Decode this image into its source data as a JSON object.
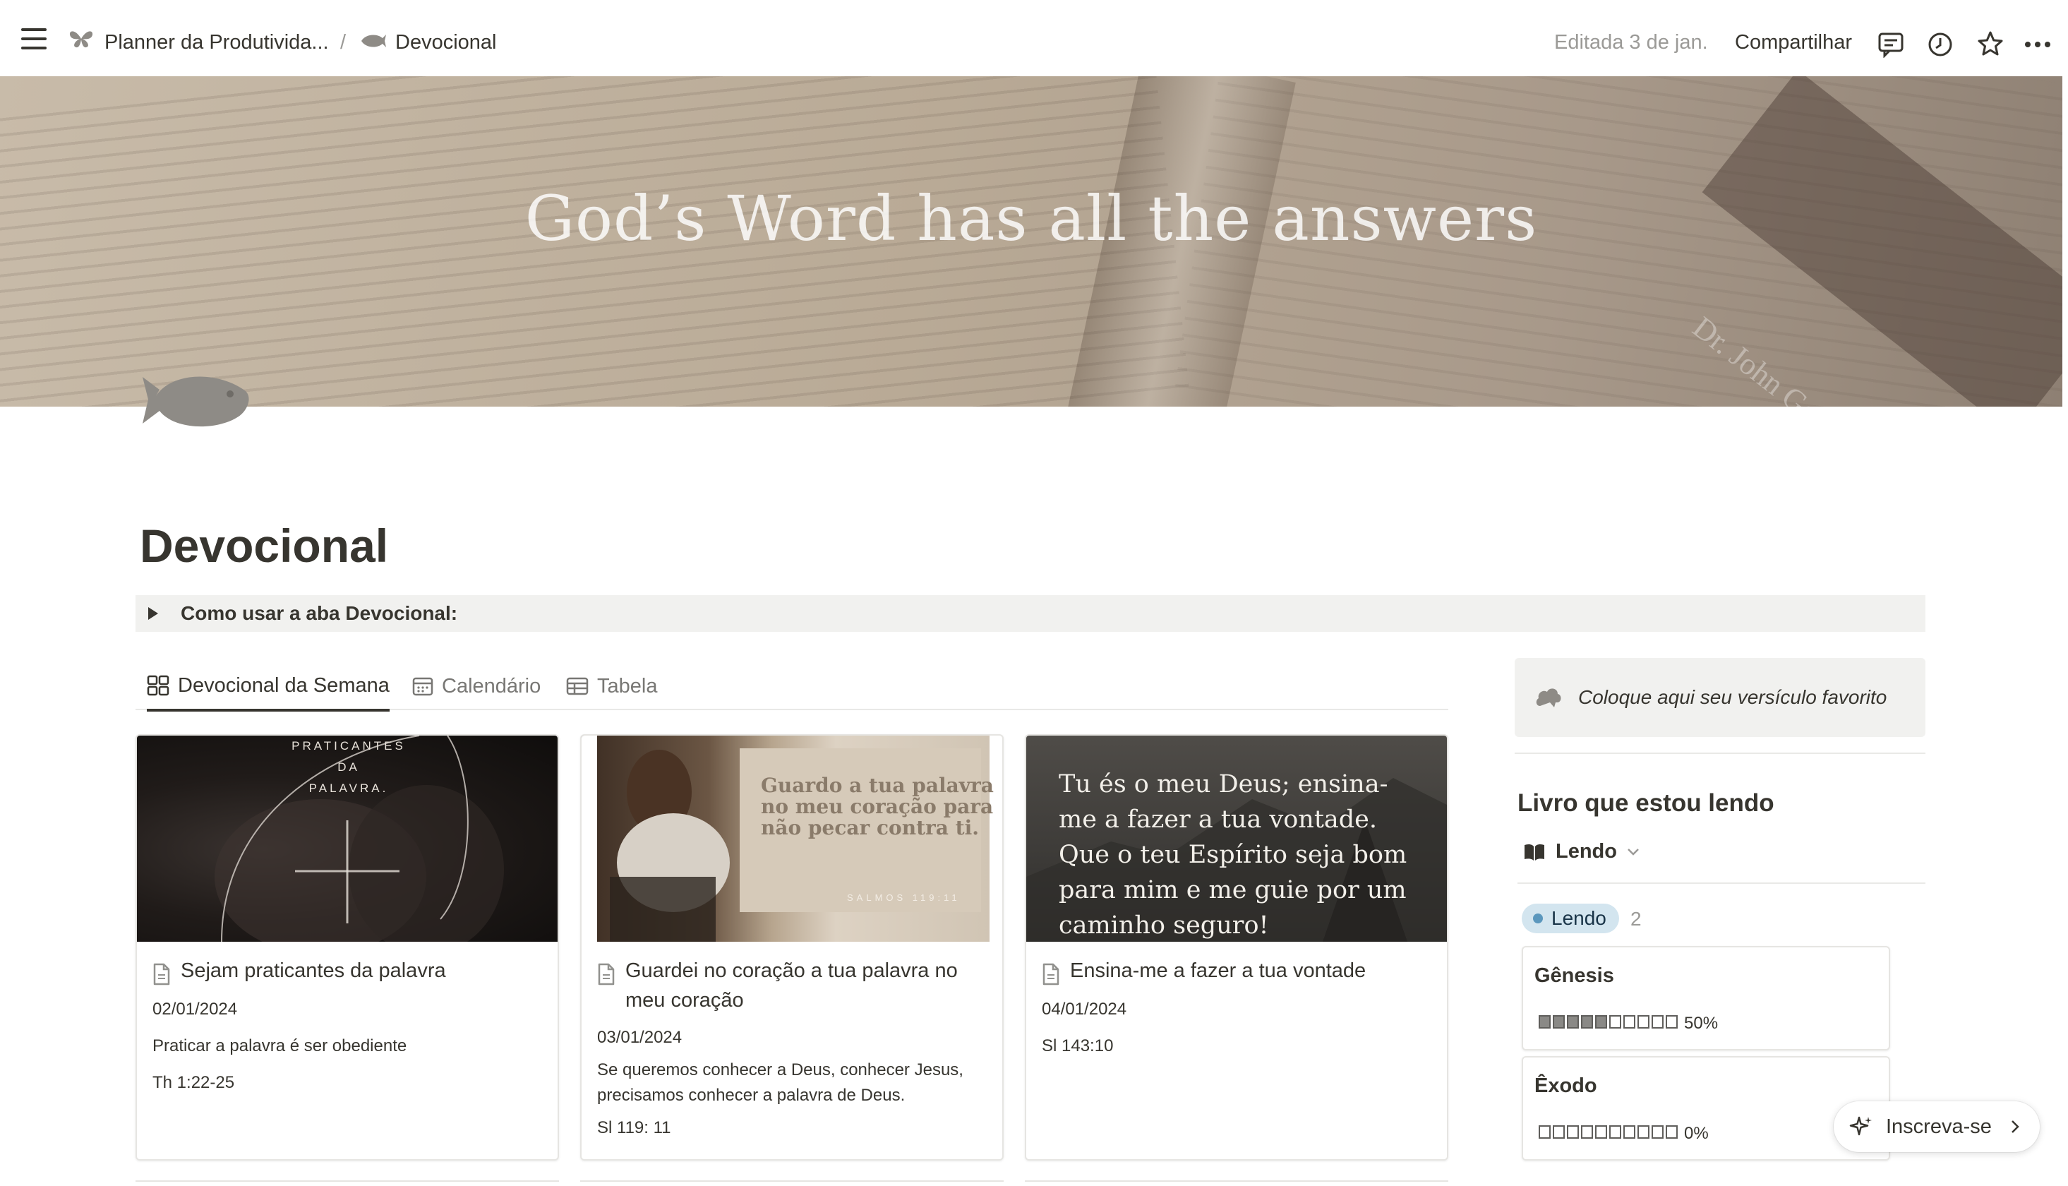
{
  "topbar": {
    "workspace": "Planner da Produtivida...",
    "separator": "/",
    "page": "Devocional",
    "edited": "Editada 3 de jan.",
    "share": "Compartilhar",
    "icons": [
      "menu-icon",
      "butterfly-icon",
      "fish-icon",
      "comment-icon",
      "history-icon",
      "star-icon",
      "more-icon"
    ]
  },
  "cover": {
    "headline": "God’s Word has all the answers",
    "stamp": "Dr. John Goetsch & D"
  },
  "page": {
    "title": "Devocional",
    "toggle_label": "Como usar a aba Devocional:"
  },
  "tabs": [
    {
      "label": "Devocional da Semana"
    },
    {
      "label": "Calendário"
    },
    {
      "label": "Tabela"
    }
  ],
  "cards": [
    {
      "thumb_text": [
        "PRATICANTES",
        "DA",
        "PALAVRA."
      ],
      "title": "Sejam praticantes da palavra",
      "date": "02/01/2024",
      "description": "Praticar a palavra é ser obediente",
      "reference": "Th 1:22-25"
    },
    {
      "thumb_text": [
        "Guardo a tua palavra",
        "no meu coração para",
        "não pecar contra ti.",
        "SALMOS 119:11"
      ],
      "title": "Guardei no coração a tua palavra no meu coração",
      "date": "03/01/2024",
      "description": "Se queremos conhecer a Deus, conhecer Jesus, precisamos conhecer a palavra de Deus.",
      "reference": "Sl 119: 11"
    },
    {
      "thumb_text": [
        "Tu és o meu Deus; ensina-",
        "me a fazer a tua vontade.",
        "Que o teu Espírito seja bom",
        "para mim e me guie por um",
        "caminho seguro!"
      ],
      "title": "Ensina-me a fazer a tua vontade",
      "date": "04/01/2024",
      "reference": "Sl 143:10"
    }
  ],
  "sidebar": {
    "callout": "Coloque aqui seu versículo favorito",
    "reading_heading": "Livro que estou lendo",
    "view_label": "Lendo",
    "group_label": "Lendo",
    "group_count": "2",
    "books": [
      {
        "name": "Gênesis",
        "progress": 0.5,
        "progress_label": "50%"
      },
      {
        "name": "Êxodo",
        "progress": 0.0,
        "progress_label": "0%"
      }
    ]
  },
  "subscribe": {
    "label": "Inscreva-se"
  },
  "colors": {
    "text": "#37352f",
    "muted": "#9b9a97",
    "tag_bg": "#d3e5ef",
    "tag_dot": "#5b97bd",
    "callout_bg": "#f1f1ef"
  }
}
